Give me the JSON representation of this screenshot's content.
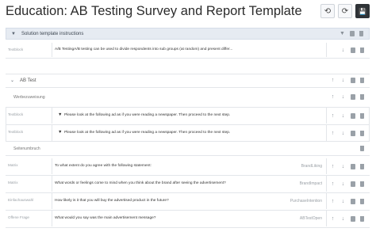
{
  "title": "Education: AB Testing Survey and Report Template",
  "header_buttons": {
    "undo": "⟲",
    "redo": "⟳",
    "save": "💾"
  },
  "sections": {
    "solution": {
      "label": "Solution template instructions",
      "row": {
        "type": "Textblock",
        "text": "A/B TestingA/B testing can be used to divide respondents into sub groups (at random) and present differ..."
      }
    },
    "ab_test": {
      "label": "AB Test",
      "group": "Werbezuweisung",
      "rows": [
        {
          "type": "Textblock",
          "text": "Please look at the following ad as if you were reading a newspaper. Then proceed to the next step."
        },
        {
          "type": "Textblock",
          "text": "Please look at the following ad as if you were reading a newspaper. Then proceed to the next step."
        }
      ],
      "pagebreak": "Seitenumbruch",
      "questions": [
        {
          "type": "Matrix",
          "text": "To what extent do you agree with the following statement:",
          "tag": "BrandLiking"
        },
        {
          "type": "Matrix",
          "text": "What words or feelings come to mind when you think about the brand after seeing the advertisement?",
          "tag": "BrandImpact"
        },
        {
          "type": "Einfachauswahl",
          "text": "How likely is it that you will buy the advertised product in the future?",
          "tag": "PurchaseIntention"
        },
        {
          "type": "Offene Frage",
          "text": "What would you say was the main advertisement message?",
          "tag": "ABTestOpen"
        }
      ]
    }
  }
}
